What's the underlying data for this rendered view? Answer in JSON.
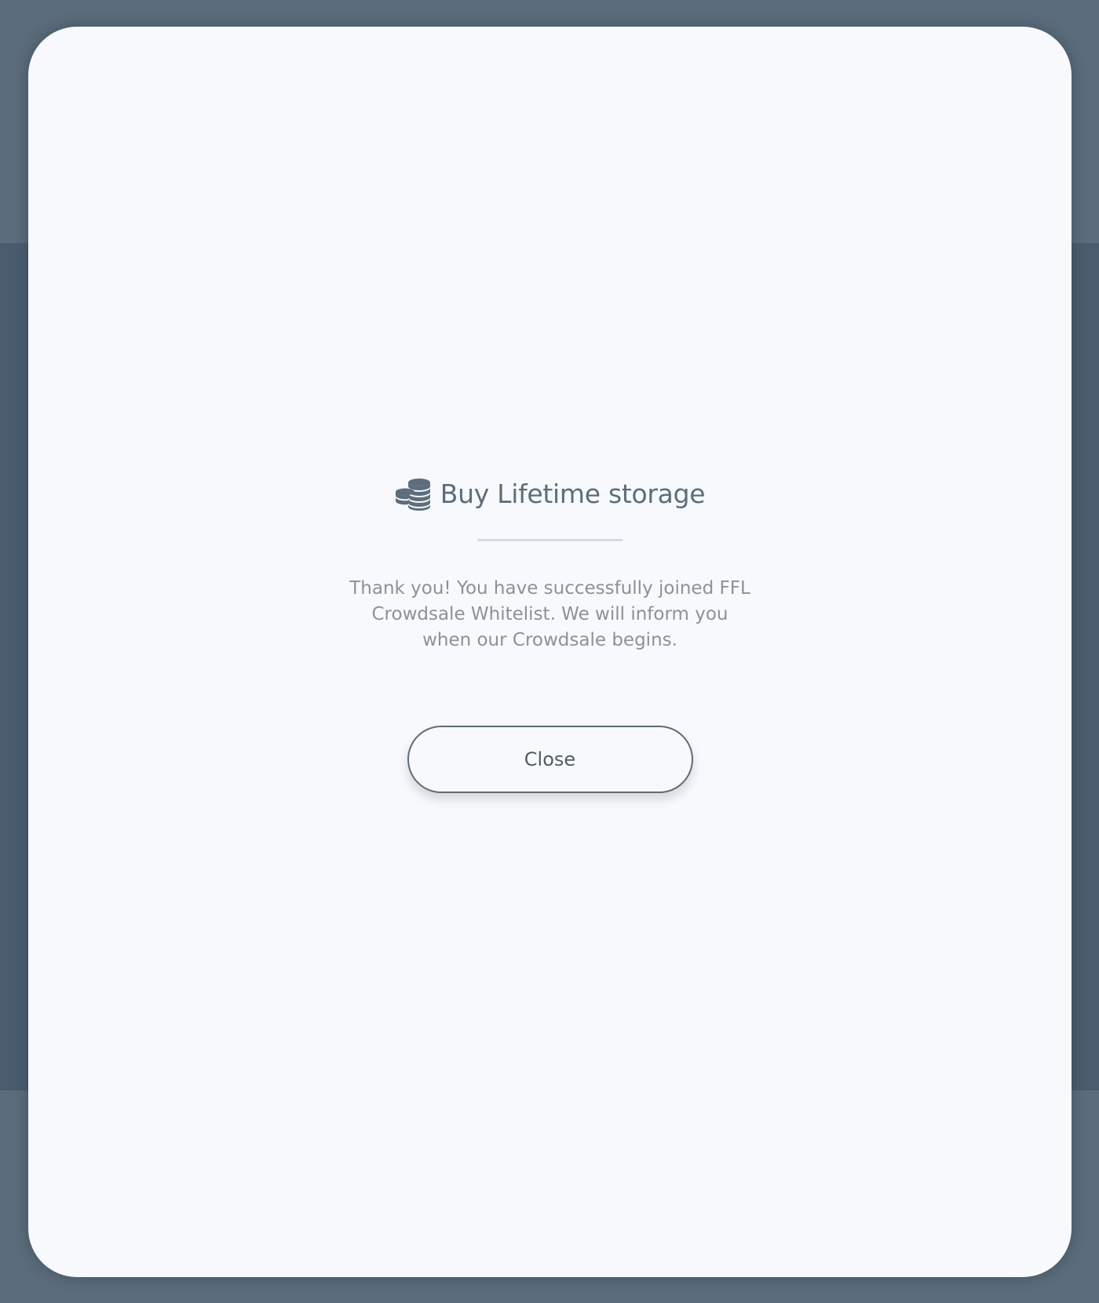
{
  "dialog": {
    "title": "Buy Lifetime storage",
    "title_icon": "coins-stack-icon",
    "message": "Thank you! You have successfully joined FFL Crowdsale Whitelist. We will inform you when our Crowdsale begins.",
    "close_label": "Close"
  },
  "colors": {
    "overlay": "#4a5d6f",
    "modal_background": "#f7f9fc",
    "title_text": "#5e6d7c",
    "message_text": "#8a929a",
    "button_border": "#5e6b78"
  }
}
